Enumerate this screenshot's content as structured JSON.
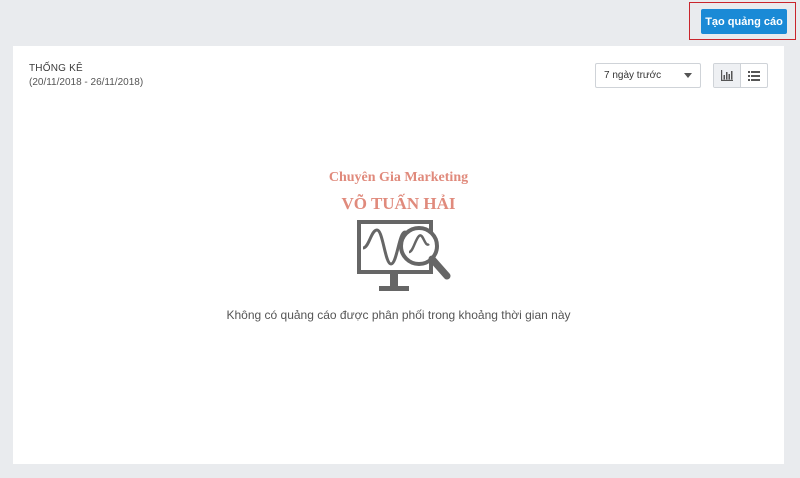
{
  "header": {
    "create_ad_label": "Tạo quảng cáo",
    "highlight_color": "#c9252c",
    "button_color": "#1a8ad6"
  },
  "stats": {
    "title": "THỐNG KÊ",
    "date_range": "(20/11/2018 - 26/11/2018)",
    "period_select": {
      "selected": "7 ngày trước"
    },
    "view_toggle": {
      "options": [
        "chart-view",
        "list-view"
      ],
      "active": "chart-view"
    }
  },
  "watermark": {
    "line1": "Chuyên Gia Marketing",
    "line2": "VÕ TUẤN HẢI"
  },
  "empty_state": {
    "icon": "monitor-magnifier-icon",
    "message": "Không có quảng cáo được phân phối trong khoảng thời gian này"
  }
}
